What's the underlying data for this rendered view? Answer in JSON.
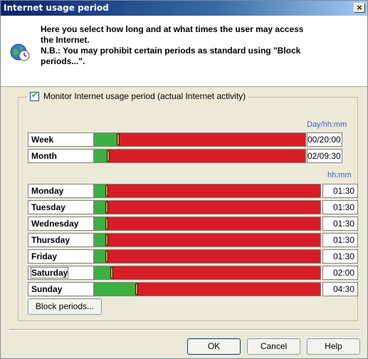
{
  "window": {
    "title": "Internet usage period",
    "close_label": "×"
  },
  "header": {
    "line1": "Here you select how long and at what times the user may access",
    "line2": "the Internet.",
    "line3": "N.B.: You may prohibit certain periods as standard using \"Block",
    "line4": "periods...\"."
  },
  "group": {
    "checkbox_checked": true,
    "checkbox_label": "Monitor Internet usage period (actual Internet activity)"
  },
  "periods": {
    "unit_label": "Day/hh:mm",
    "rows": [
      {
        "label": "Week",
        "value": "00/20:00",
        "fraction": 0.113
      },
      {
        "label": "Month",
        "value": "02/09:30",
        "fraction": 0.065
      }
    ]
  },
  "days": {
    "unit_label": "hh:mm",
    "rows": [
      {
        "label": "Monday",
        "value": "01:30",
        "fraction": 0.055,
        "focused": false
      },
      {
        "label": "Tuesday",
        "value": "01:30",
        "fraction": 0.055,
        "focused": false
      },
      {
        "label": "Wednesday",
        "value": "01:30",
        "fraction": 0.055,
        "focused": false
      },
      {
        "label": "Thursday",
        "value": "01:30",
        "fraction": 0.055,
        "focused": false
      },
      {
        "label": "Friday",
        "value": "01:30",
        "fraction": 0.055,
        "focused": false
      },
      {
        "label": "Saturday",
        "value": "02:00",
        "fraction": 0.075,
        "focused": true
      },
      {
        "label": "Sunday",
        "value": "04:30",
        "fraction": 0.185,
        "focused": false
      }
    ]
  },
  "buttons": {
    "block_periods": "Block periods...",
    "ok": "OK",
    "cancel": "Cancel",
    "help": "Help"
  },
  "colors": {
    "allowed": "#3cb040",
    "blocked": "#d71e28",
    "handle": "#d7a341",
    "title_bar": "#0a246a"
  },
  "icons": {
    "header_icon": "globe-clock-icon",
    "checkbox_icon": "checkmark-icon"
  }
}
